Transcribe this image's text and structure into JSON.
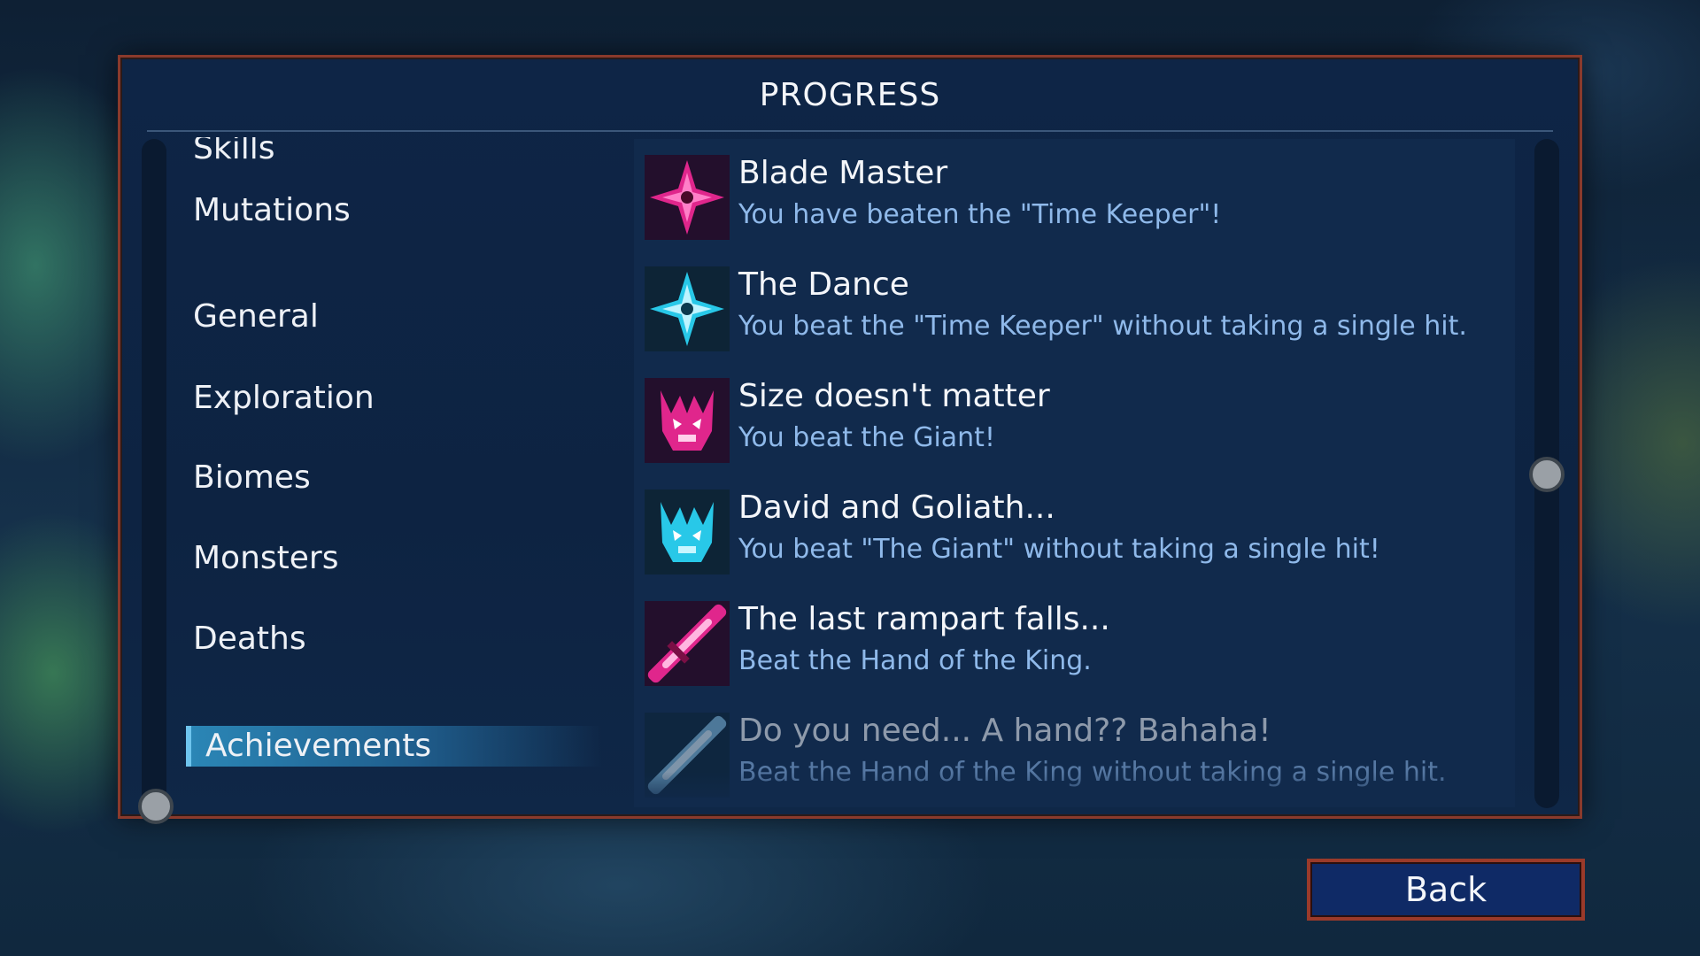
{
  "title": "PROGRESS",
  "categories": [
    "Skills",
    "Mutations",
    "General",
    "Exploration",
    "Biomes",
    "Monsters",
    "Deaths",
    "Achievements"
  ],
  "selected_category": "Achievements",
  "achievements": [
    {
      "name": "Blade Master",
      "description": "You have beaten the \"Time Keeper\"!",
      "icon": "shuriken-pink-icon",
      "color": "#e0268c"
    },
    {
      "name": "The Dance",
      "description": "You beat the \"Time Keeper\" without taking a single hit.",
      "icon": "shuriken-cyan-icon",
      "color": "#28c8e8"
    },
    {
      "name": "Size doesn't matter",
      "description": "You beat the Giant!",
      "icon": "giant-pink-icon",
      "color": "#e0268c"
    },
    {
      "name": "David and Goliath...",
      "description": "You beat \"The Giant\" without taking a single hit!",
      "icon": "giant-cyan-icon",
      "color": "#28c8e8"
    },
    {
      "name": "The last rampart falls...",
      "description": "Beat the Hand of the King.",
      "icon": "sword-pink-icon",
      "color": "#e0268c"
    },
    {
      "name": "Do you need... A hand?? Bahaha!",
      "description": "Beat the Hand of the King without taking a single hit.",
      "icon": "sword-cyan-icon",
      "color": "#28c8e8"
    }
  ],
  "back_label": "Back"
}
